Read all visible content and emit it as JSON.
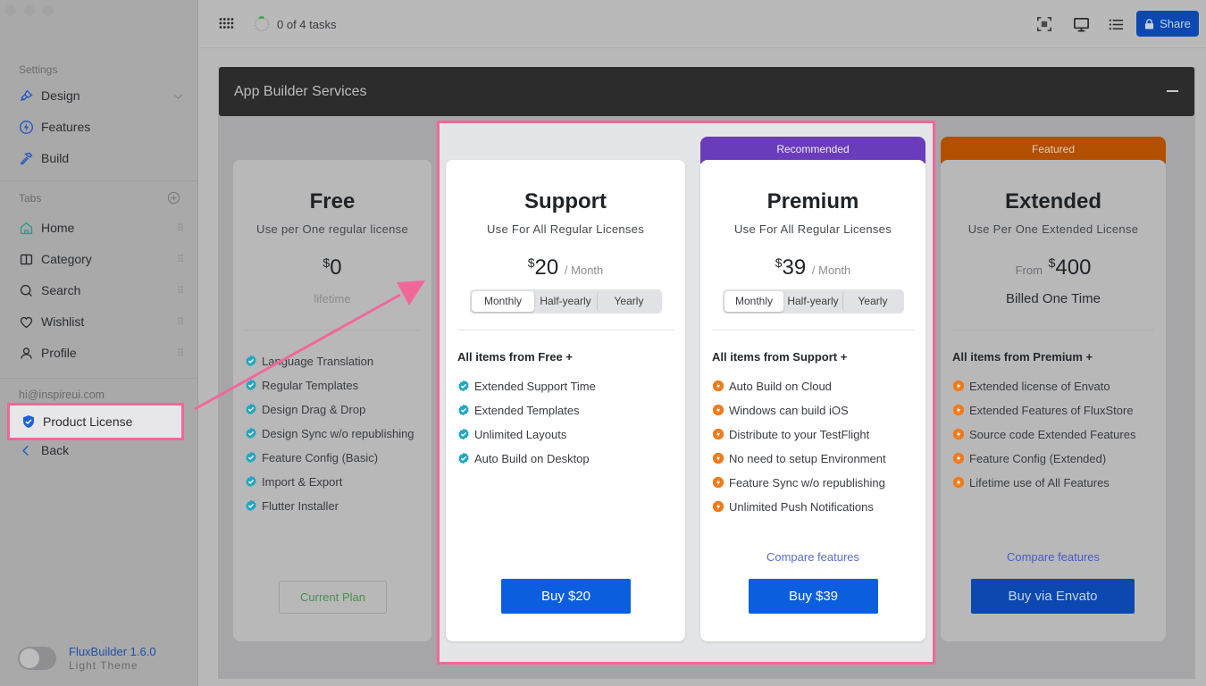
{
  "sidebar": {
    "settings_label": "Settings",
    "settings_items": [
      {
        "label": "Design",
        "icon": "paintbrush-icon"
      },
      {
        "label": "Features",
        "icon": "bolt-circle-icon"
      },
      {
        "label": "Build",
        "icon": "hammer-icon"
      }
    ],
    "tabs_label": "Tabs",
    "tabs": [
      {
        "label": "Home",
        "icon": "home-icon"
      },
      {
        "label": "Category",
        "icon": "columns-icon"
      },
      {
        "label": "Search",
        "icon": "search-icon"
      },
      {
        "label": "Wishlist",
        "icon": "heart-icon"
      },
      {
        "label": "Profile",
        "icon": "user-icon"
      }
    ],
    "email": "hi@inspireui.com",
    "product_license": "Product License",
    "back": "Back",
    "app_name": "FluxBuilder 1.6.0",
    "theme": "Light Theme",
    "theme_toggle_on": false
  },
  "topbar": {
    "tasks": "0 of 4 tasks",
    "tasks_progress": 0,
    "share": "Share"
  },
  "panel": {
    "title": "App Builder Services"
  },
  "plans": [
    {
      "name": "Free",
      "subtitle": "Use per One regular license",
      "currency": "$",
      "price": "0",
      "period_note": "lifetime",
      "features": [
        "Language Translation",
        "Regular Templates",
        "Design Drag & Drop",
        "Design Sync w/o republishing",
        "Feature Config (Basic)",
        "Import & Export",
        "Flutter Installer"
      ],
      "button": "Current Plan"
    },
    {
      "name": "Support",
      "subtitle": "Use For All Regular Licenses",
      "currency": "$",
      "price": "20",
      "per": "/ Month",
      "billing_options": [
        "Monthly",
        "Half-yearly",
        "Yearly"
      ],
      "billing_selected": "Monthly",
      "feature_head": "All items from Free  +",
      "features": [
        "Extended Support Time",
        "Extended Templates",
        "Unlimited Layouts",
        "Auto Build on Desktop"
      ],
      "button": "Buy $20"
    },
    {
      "name": "Premium",
      "ribbon": "Recommended",
      "ribbon_color": "#6a3cbc",
      "subtitle": "Use For All Regular Licenses",
      "currency": "$",
      "price": "39",
      "per": "/ Month",
      "billing_options": [
        "Monthly",
        "Half-yearly",
        "Yearly"
      ],
      "billing_selected": "Monthly",
      "feature_head": "All items from Support  +",
      "features": [
        "Auto Build on Cloud",
        "Windows can build iOS",
        "Distribute to your TestFlight",
        "No need to setup Environment",
        "Feature Sync w/o republishing",
        "Unlimited Push Notifications"
      ],
      "compare": "Compare features",
      "button": "Buy $39"
    },
    {
      "name": "Extended",
      "ribbon": "Featured",
      "ribbon_color": "#b24f00",
      "subtitle": "Use Per One Extended License",
      "from": "From",
      "currency": "$",
      "price": "400",
      "billed": "Billed One Time",
      "feature_head": "All items from Premium +",
      "features": [
        "Extended license of Envato",
        "Extended Features of FluxStore",
        "Source code Extended Features",
        "Feature Config (Extended)",
        "Lifetime use of All Features"
      ],
      "compare": "Compare features",
      "button": "Buy via Envato"
    }
  ],
  "colors": {
    "accent_blue": "#0b5fde",
    "highlight_pink": "#f2679a",
    "check_teal": "#22a6c4",
    "bolt_orange": "#f07a1a"
  }
}
